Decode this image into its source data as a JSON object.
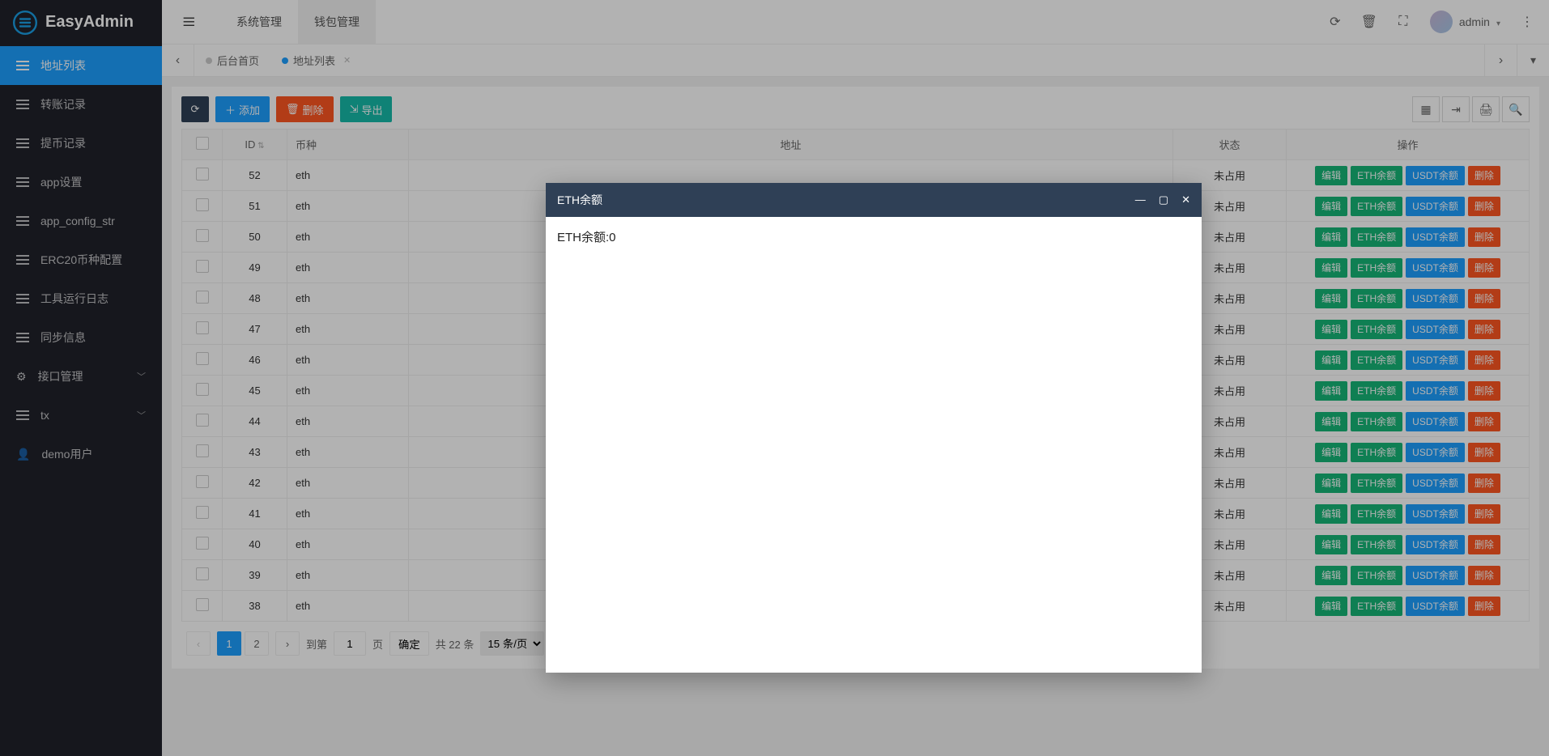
{
  "app_name": "EasyAdmin",
  "top_tabs": [
    "系统管理",
    "钱包管理"
  ],
  "top_tabs_active": 1,
  "user_name": "admin",
  "sidebar": [
    {
      "label": "地址列表",
      "active": true,
      "icon": "list"
    },
    {
      "label": "转账记录",
      "icon": "list"
    },
    {
      "label": "提币记录",
      "icon": "list"
    },
    {
      "label": "app设置",
      "icon": "list"
    },
    {
      "label": "app_config_str",
      "icon": "list"
    },
    {
      "label": "ERC20币种配置",
      "icon": "list"
    },
    {
      "label": "工具运行日志",
      "icon": "list"
    },
    {
      "label": "同步信息",
      "icon": "list"
    },
    {
      "label": "接口管理",
      "icon": "car",
      "chev": true
    },
    {
      "label": "tx",
      "icon": "list",
      "chev": true
    },
    {
      "label": "demo用户",
      "icon": "user"
    }
  ],
  "page_tabs": [
    {
      "label": "后台首页",
      "active": false,
      "closable": false
    },
    {
      "label": "地址列表",
      "active": true,
      "closable": true
    }
  ],
  "toolbar": {
    "add": "添加",
    "delete": "删除",
    "export": "导出"
  },
  "columns": {
    "id": "ID",
    "coin": "币种",
    "addr": "地址",
    "status": "状态",
    "ops": "操作"
  },
  "row_actions": {
    "edit": "编辑",
    "eth": "ETH余额",
    "usdt": "USDT余额",
    "del": "删除"
  },
  "rows": [
    {
      "id": 52,
      "coin": "eth",
      "addr": "",
      "status": "未占用"
    },
    {
      "id": 51,
      "coin": "eth",
      "addr": "",
      "status": "未占用"
    },
    {
      "id": 50,
      "coin": "eth",
      "addr": "",
      "status": "未占用"
    },
    {
      "id": 49,
      "coin": "eth",
      "addr": "",
      "status": "未占用"
    },
    {
      "id": 48,
      "coin": "eth",
      "addr": "",
      "status": "未占用"
    },
    {
      "id": 47,
      "coin": "eth",
      "addr": "",
      "status": "未占用"
    },
    {
      "id": 46,
      "coin": "eth",
      "addr": "",
      "status": "未占用"
    },
    {
      "id": 45,
      "coin": "eth",
      "addr": "",
      "status": "未占用"
    },
    {
      "id": 44,
      "coin": "eth",
      "addr": "",
      "status": "未占用"
    },
    {
      "id": 43,
      "coin": "eth",
      "addr": "",
      "status": "未占用"
    },
    {
      "id": 42,
      "coin": "eth",
      "addr": "",
      "status": "未占用"
    },
    {
      "id": 41,
      "coin": "eth",
      "addr": "",
      "status": "未占用"
    },
    {
      "id": 40,
      "coin": "eth",
      "addr": "",
      "status": "未占用"
    },
    {
      "id": 39,
      "coin": "eth",
      "addr": "",
      "status": "未占用"
    },
    {
      "id": 38,
      "coin": "eth",
      "addr": "",
      "status": "未占用"
    }
  ],
  "pager": {
    "pages": [
      1,
      2
    ],
    "current": 1,
    "jump_label": "到第",
    "page_label": "页",
    "confirm": "确定",
    "total_label": "共 22 条",
    "per_page": "15 条/页",
    "jump_value": "1"
  },
  "modal": {
    "title": "ETH余额",
    "body": "ETH余额:0"
  }
}
